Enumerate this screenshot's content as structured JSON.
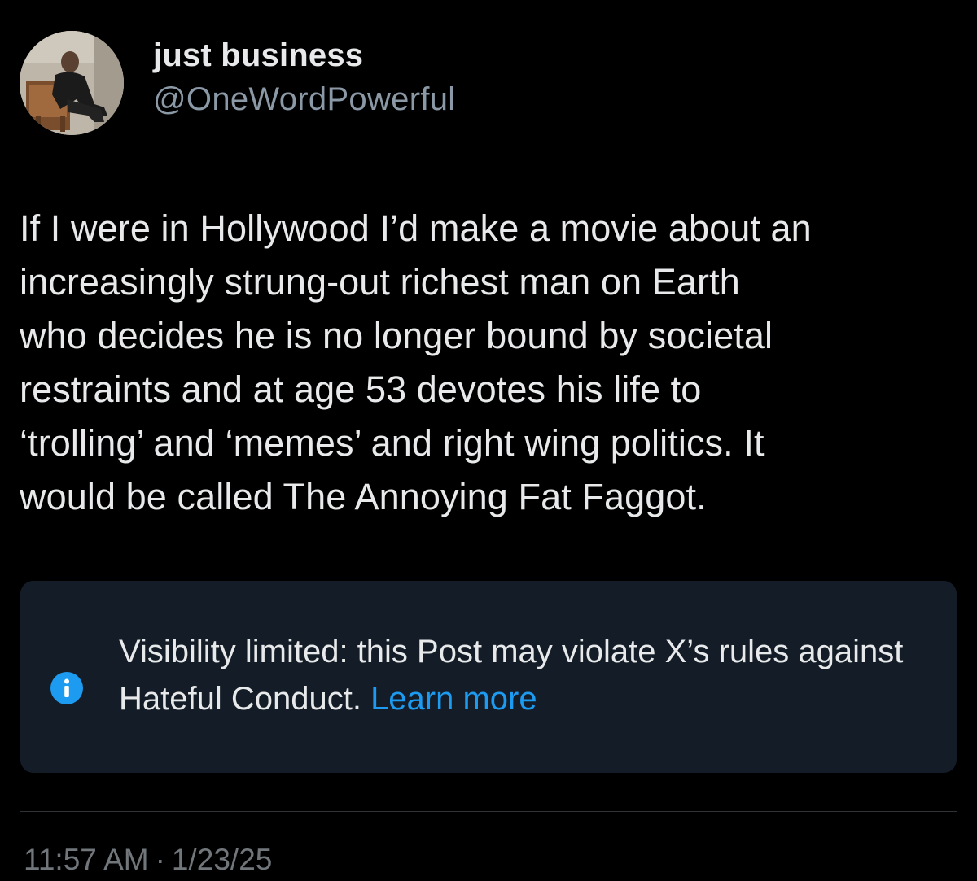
{
  "author": {
    "display_name": "just business",
    "handle": "@OneWordPowerful",
    "avatar_icon": "profile-photo"
  },
  "post": {
    "text": "If I were in Hollywood I’d make a movie about an\nincreasingly strung-out richest man on Earth\nwho decides he is no longer bound by societal\nrestraints and at age 53 devotes his life to\n‘trolling’ and ‘memes’ and right wing politics. It\nwould be called The Annoying Fat Faggot."
  },
  "notice": {
    "icon": "info-icon",
    "text": "Visibility limited: this Post may violate X’s rules against Hateful Conduct. ",
    "link_label": "Learn more",
    "link_color": "#1d9bf0",
    "background_color": "#141d27"
  },
  "meta": {
    "time": "11:57 AM",
    "separator": "·",
    "date": "1/23/25"
  }
}
